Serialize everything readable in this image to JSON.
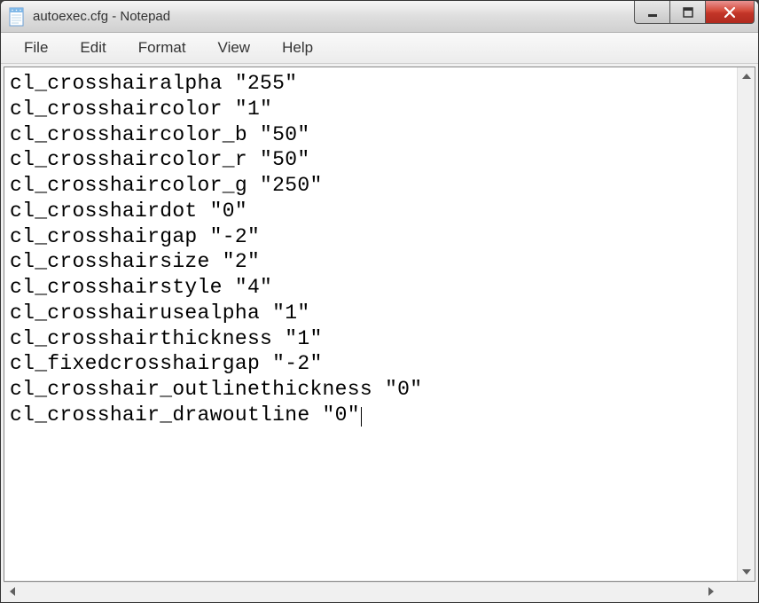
{
  "window": {
    "title": "autoexec.cfg - Notepad"
  },
  "menu": {
    "file": "File",
    "edit": "Edit",
    "format": "Format",
    "view": "View",
    "help": "Help"
  },
  "editor": {
    "lines": [
      "cl_crosshairalpha \"255\"",
      "cl_crosshaircolor \"1\"",
      "cl_crosshaircolor_b \"50\"",
      "cl_crosshaircolor_r \"50\"",
      "cl_crosshaircolor_g \"250\"",
      "cl_crosshairdot \"0\"",
      "cl_crosshairgap \"-2\"",
      "cl_crosshairsize \"2\"",
      "cl_crosshairstyle \"4\"",
      "cl_crosshairusealpha \"1\"",
      "cl_crosshairthickness \"1\"",
      "cl_fixedcrosshairgap \"-2\"",
      "cl_crosshair_outlinethickness \"0\"",
      "cl_crosshair_drawoutline \"0\""
    ]
  }
}
